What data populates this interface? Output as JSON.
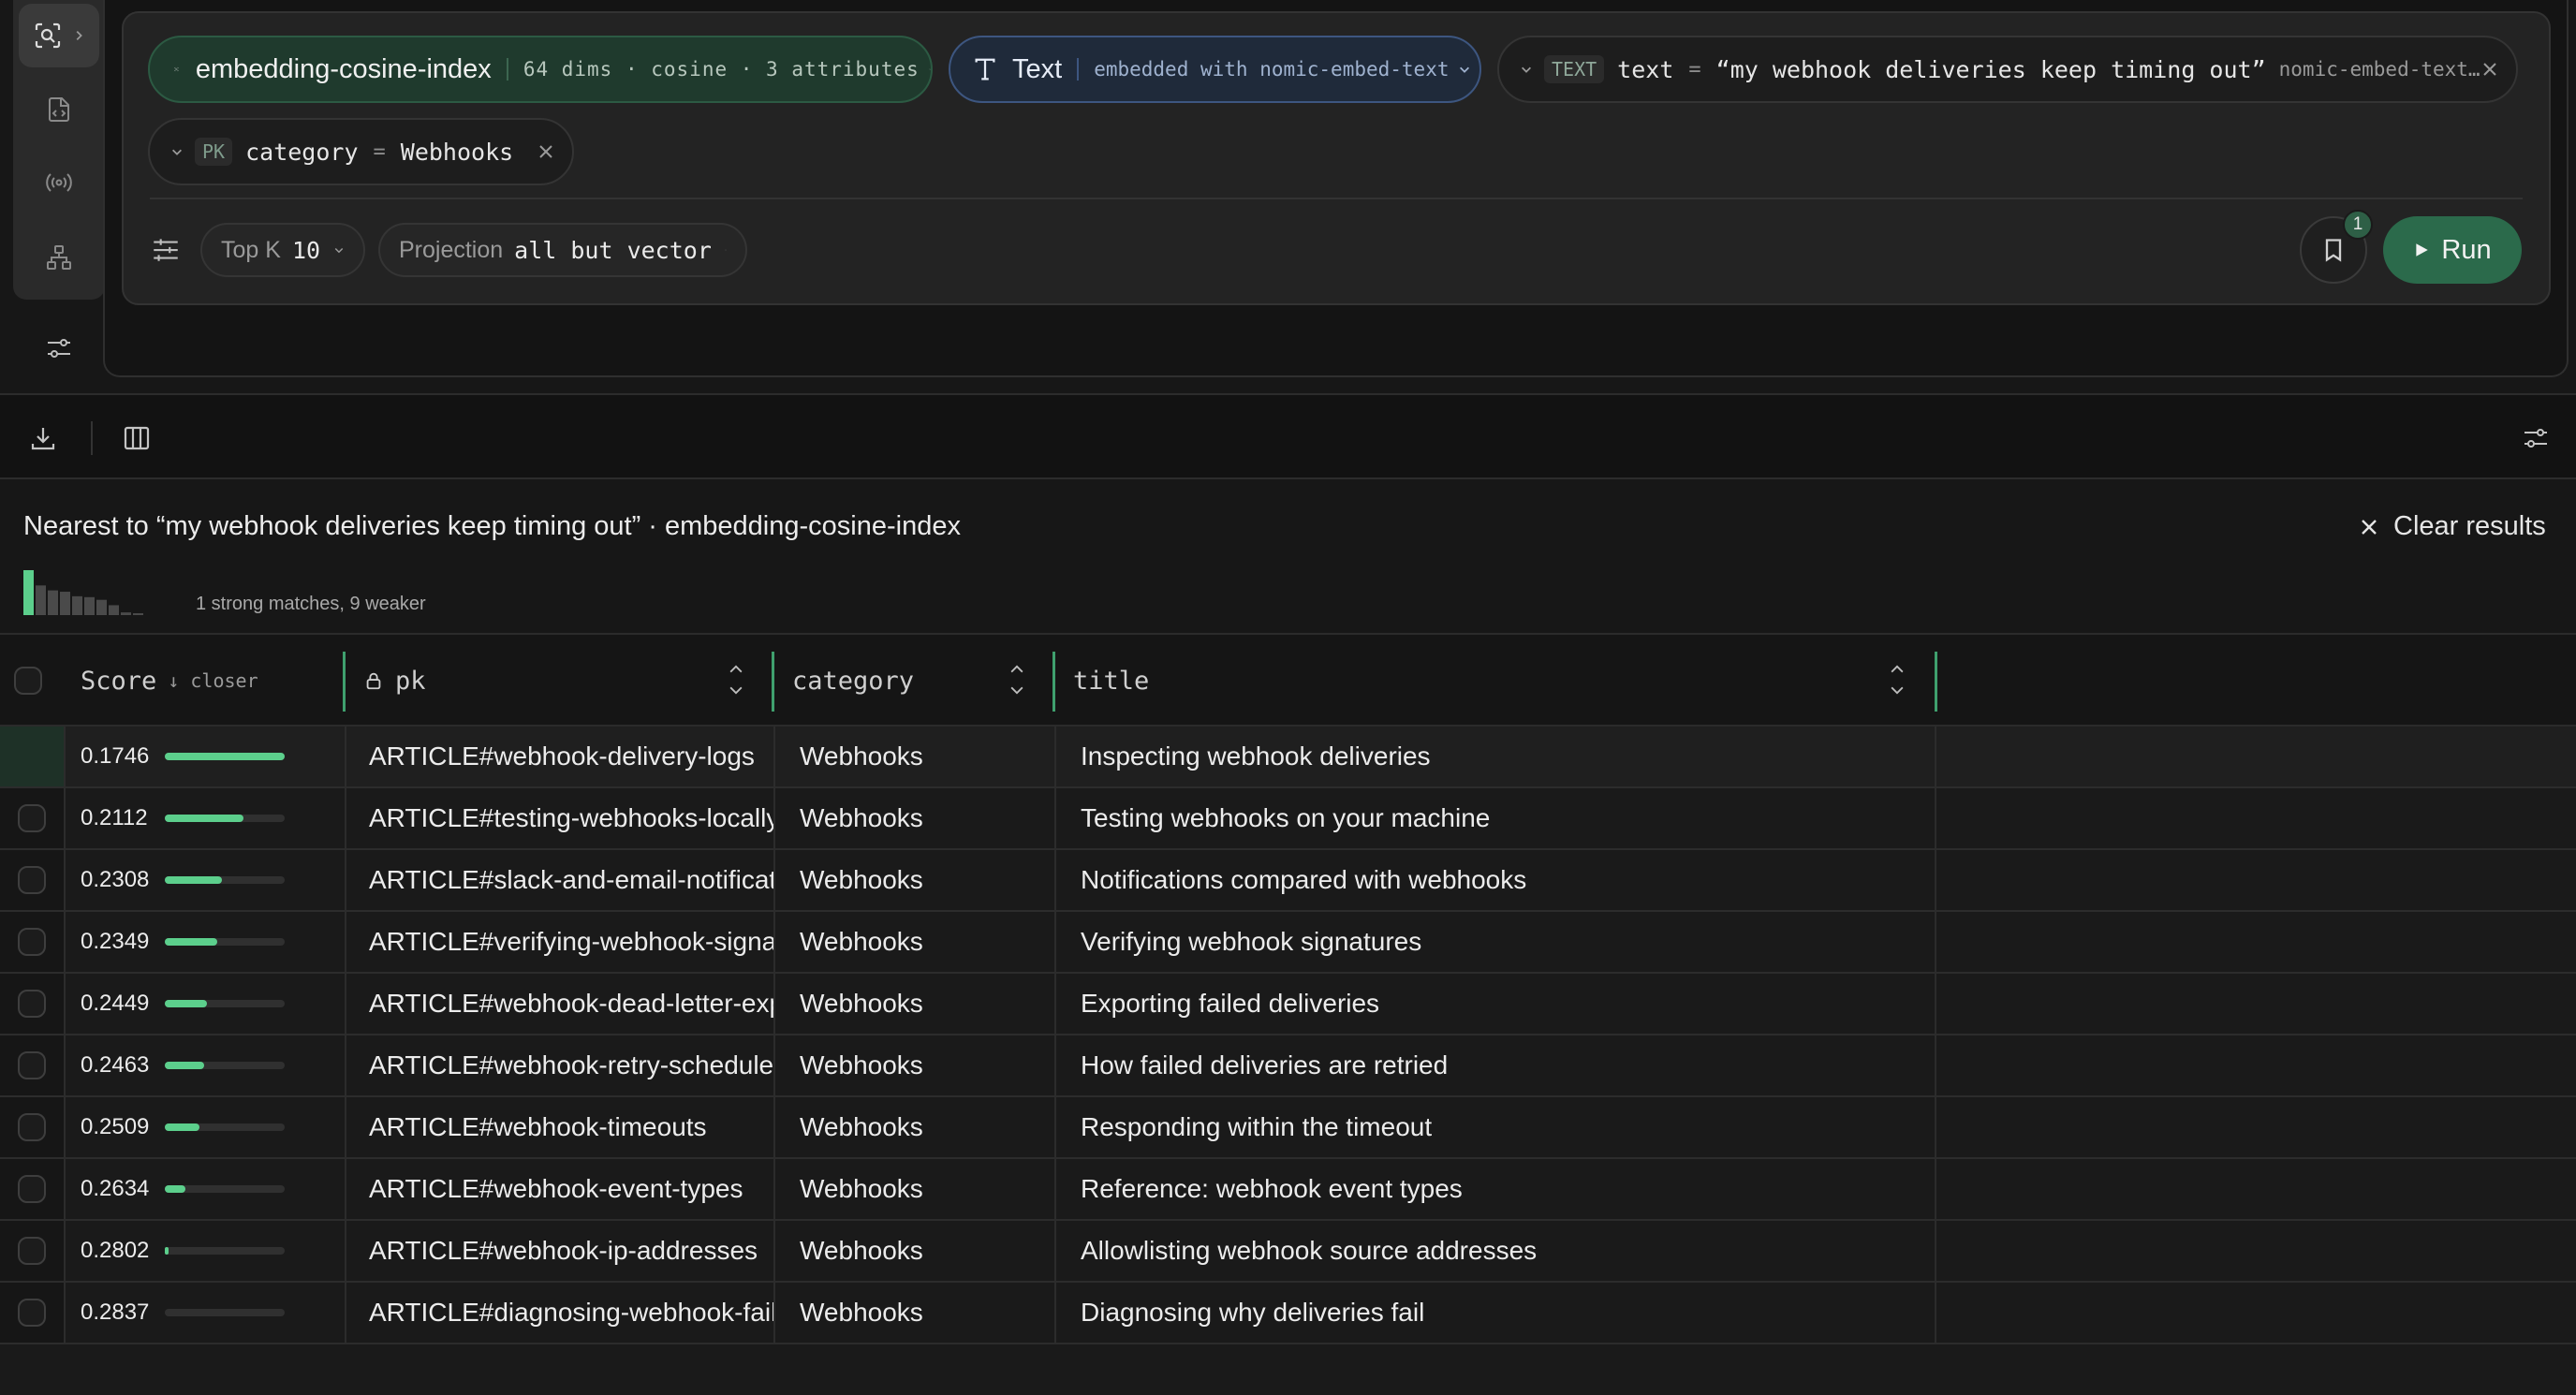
{
  "query": {
    "index_name": "embedding-cosine-index",
    "index_meta": "64 dims · cosine · 3 attributes",
    "mode_label": "Text",
    "mode_meta": "embedded with nomic-embed-text",
    "text_filter": {
      "tag": "TEXT",
      "key": "text",
      "op": "=",
      "value": "“my webhook deliveries keep timing out”",
      "model": "nomic-embed-text…"
    },
    "pk_filter": {
      "tag": "PK",
      "key": "category",
      "op": "=",
      "value": "Webhooks"
    },
    "top_k_label": "Top K",
    "top_k_value": "10",
    "projection_label": "Projection",
    "projection_value": "all but vector",
    "bookmark_count": "1",
    "run_label": "Run"
  },
  "results": {
    "title": "Nearest to “my webhook deliveries keep timing out” · embedding-cosine-index",
    "clear_label": "Clear results",
    "summary": "1 strong matches, 9 weaker",
    "histogram": [
      1.0,
      0.66,
      0.55,
      0.52,
      0.42,
      0.4,
      0.34,
      0.22,
      0.06,
      0.04
    ],
    "columns": {
      "score": "Score",
      "score_sort": "↓ closer",
      "pk": "pk",
      "category": "category",
      "title": "title"
    },
    "rows": [
      {
        "score": "0.1746",
        "bar": 1.0,
        "pk": "ARTICLE#webhook-delivery-logs",
        "category": "Webhooks",
        "title": "Inspecting webhook deliveries"
      },
      {
        "score": "0.2112",
        "bar": 0.66,
        "pk": "ARTICLE#testing-webhooks-locally",
        "category": "Webhooks",
        "title": "Testing webhooks on your machine"
      },
      {
        "score": "0.2308",
        "bar": 0.48,
        "pk": "ARTICLE#slack-and-email-notificati",
        "category": "Webhooks",
        "title": "Notifications compared with webhooks"
      },
      {
        "score": "0.2349",
        "bar": 0.44,
        "pk": "ARTICLE#verifying-webhook-signat",
        "category": "Webhooks",
        "title": "Verifying webhook signatures"
      },
      {
        "score": "0.2449",
        "bar": 0.35,
        "pk": "ARTICLE#webhook-dead-letter-exp",
        "category": "Webhooks",
        "title": "Exporting failed deliveries"
      },
      {
        "score": "0.2463",
        "bar": 0.33,
        "pk": "ARTICLE#webhook-retry-schedule",
        "category": "Webhooks",
        "title": "How failed deliveries are retried"
      },
      {
        "score": "0.2509",
        "bar": 0.29,
        "pk": "ARTICLE#webhook-timeouts",
        "category": "Webhooks",
        "title": "Responding within the timeout"
      },
      {
        "score": "0.2634",
        "bar": 0.17,
        "pk": "ARTICLE#webhook-event-types",
        "category": "Webhooks",
        "title": "Reference: webhook event types"
      },
      {
        "score": "0.2802",
        "bar": 0.03,
        "pk": "ARTICLE#webhook-ip-addresses",
        "category": "Webhooks",
        "title": "Allowlisting webhook source addresses"
      },
      {
        "score": "0.2837",
        "bar": 0.0,
        "pk": "ARTICLE#diagnosing-webhook-failu",
        "category": "Webhooks",
        "title": "Diagnosing why deliveries fail"
      }
    ]
  },
  "colors": {
    "accent": "#5ccf8c",
    "run_button": "#2b6a4b",
    "index_chip": "#1f3a2d",
    "text_chip": "#1f2a3a"
  },
  "icons": {
    "rail": [
      "vector-search-icon",
      "code-file-icon",
      "broadcast-icon",
      "hierarchy-icon",
      "sliders-icon"
    ],
    "toolbar": [
      "download-icon",
      "columns-icon",
      "sliders-icon"
    ]
  }
}
